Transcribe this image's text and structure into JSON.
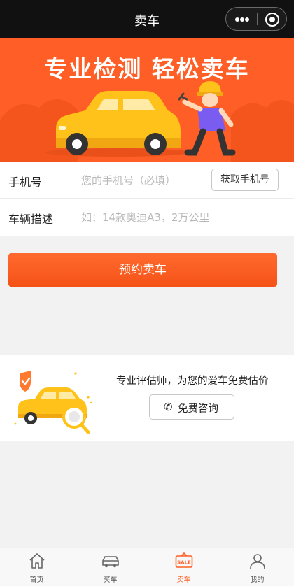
{
  "titlebar": {
    "title": "卖车",
    "more_icon": "more-dots-icon",
    "close_icon": "target-circle-icon"
  },
  "banner": {
    "slogan": "专业检测  轻松卖车",
    "background": "#ff5f26"
  },
  "form": {
    "phone": {
      "label": "手机号",
      "placeholder": "您的手机号（必填）",
      "value": "",
      "button": "获取手机号"
    },
    "vehicle": {
      "label": "车辆描述",
      "placeholder": "如：14款奥迪A3，2万公里",
      "value": ""
    }
  },
  "submit": {
    "label": "预约卖车",
    "color": "#ff5f26"
  },
  "appraisal": {
    "text": "专业评估师，为您的爱车免费估价",
    "button": "免费咨询",
    "button_icon": "phone-icon"
  },
  "tabbar": {
    "accent": "#ff5f26",
    "items": [
      {
        "label": "首页",
        "icon": "home-icon"
      },
      {
        "label": "买车",
        "icon": "car-icon"
      },
      {
        "label": "卖车",
        "icon": "sale-tag-icon",
        "active": true
      },
      {
        "label": "我的",
        "icon": "person-icon"
      }
    ]
  }
}
